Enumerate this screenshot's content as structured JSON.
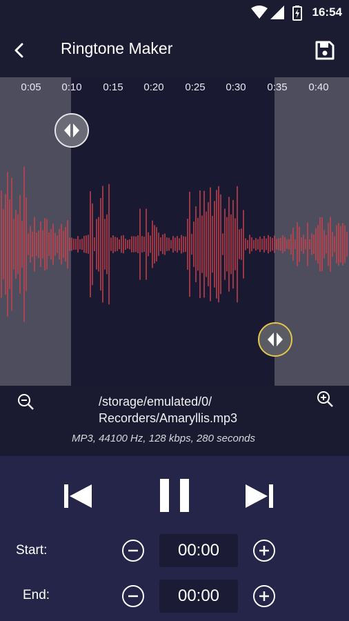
{
  "status_bar": {
    "time": "16:54",
    "icons": [
      "wifi-icon",
      "signal-icon",
      "battery-icon"
    ]
  },
  "app_bar": {
    "title": "Ringtone Maker",
    "back_icon": "arrow-back-icon",
    "save_icon": "save-icon"
  },
  "timeline": {
    "ticks": [
      "0:05",
      "0:10",
      "0:15",
      "0:20",
      "0:25",
      "0:30",
      "0:35",
      "0:40"
    ]
  },
  "file": {
    "path_line1": "/storage/emulated/0/",
    "path_line2": "Recorders/Amaryllis.mp3",
    "meta": "MP3, 44100 Hz, 128 kbps, 280 seconds"
  },
  "playback": {
    "prev_icon": "skip-previous-icon",
    "pause_icon": "pause-icon",
    "next_icon": "skip-next-icon"
  },
  "start": {
    "label": "Start:",
    "value": "00:00"
  },
  "end": {
    "label": "End:",
    "value": "00:00"
  },
  "colors": {
    "waveform": "#c9434e",
    "background": "#1a1a2e",
    "controls_bg": "#25254a",
    "handle_accent": "#e4c74a"
  }
}
